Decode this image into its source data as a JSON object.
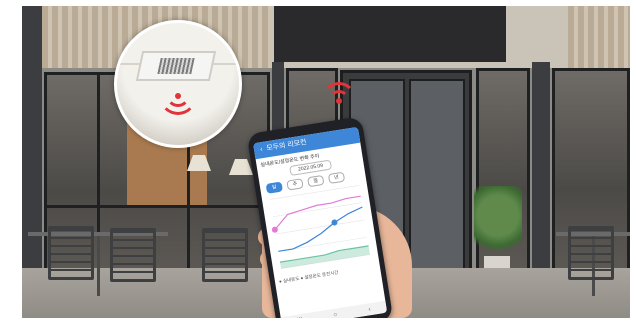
{
  "phone_app": {
    "title": "모두의 리모컨",
    "subtitle": "실내온도/설정온도 변화 추이",
    "date_range": "2022.05.09",
    "period_tabs": [
      "일",
      "주",
      "월",
      "년"
    ],
    "legend_note": "● 실내온도  ● 설정온도  운전시간"
  },
  "chart_data": {
    "type": "line",
    "series": [
      {
        "values": [
          18,
          24,
          25,
          26,
          26,
          27,
          27
        ]
      },
      {
        "values": [
          8,
          8,
          10,
          13,
          17,
          20,
          22
        ]
      },
      {
        "values": [
          3,
          3,
          3,
          3,
          4,
          4,
          4
        ]
      }
    ],
    "ylim": [
      0,
      32
    ]
  },
  "colors": {
    "wave": "#e0343a",
    "app_accent": "#3d86d8",
    "series_pink": "#e27bd5",
    "series_blue": "#3d86d8",
    "series_green": "#6cc3a0"
  }
}
